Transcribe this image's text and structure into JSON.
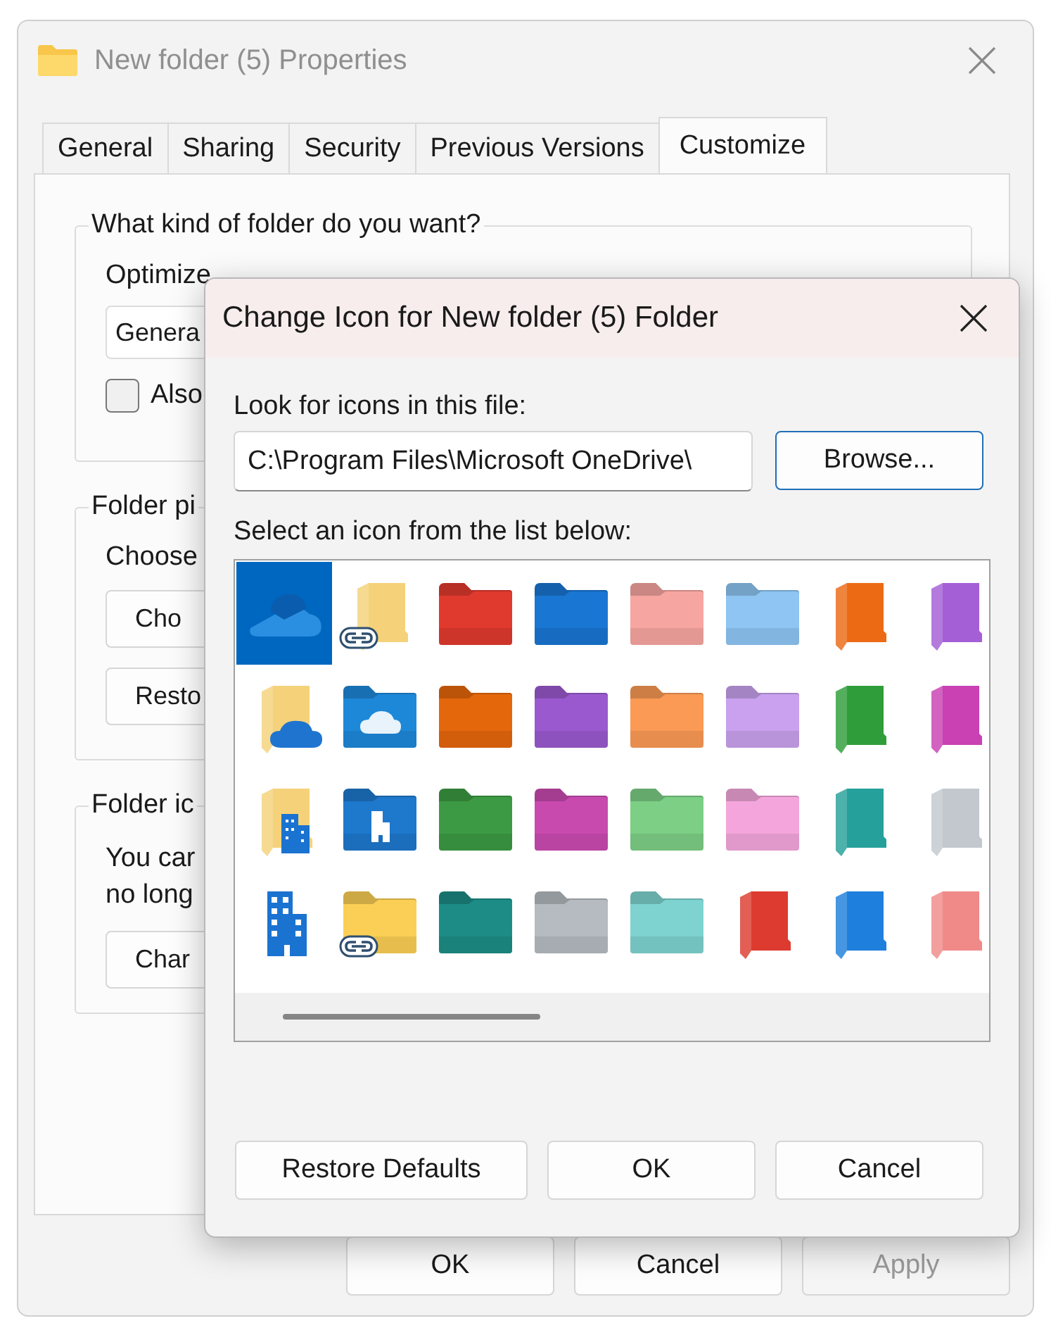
{
  "back_window": {
    "title": "New folder (5) Properties",
    "tabs": [
      {
        "label": "General",
        "selected": false
      },
      {
        "label": "Sharing",
        "selected": false
      },
      {
        "label": "Security",
        "selected": false
      },
      {
        "label": "Previous Versions",
        "selected": false
      },
      {
        "label": "Customize",
        "selected": true
      }
    ],
    "folder_type_group": {
      "legend": "What kind of folder do you want?",
      "optimize_label": "Optimize",
      "dropdown_value": "Genera",
      "checkbox": {
        "label": "Also",
        "checked": false
      }
    },
    "pictures_group": {
      "legend": "Folder pi",
      "text": "Choose",
      "buttons": [
        "Cho",
        "Resto"
      ]
    },
    "icons_group": {
      "legend": "Folder ic",
      "text_lines": [
        "You car",
        "no long"
      ],
      "button": "Char"
    },
    "buttons": [
      {
        "label": "OK",
        "disabled": false
      },
      {
        "label": "Cancel",
        "disabled": false
      },
      {
        "label": "Apply",
        "disabled": true
      }
    ]
  },
  "dialog": {
    "title": "Change Icon for New folder (5) Folder",
    "file_label": "Look for icons in this file:",
    "file_value": "C:\\Program Files\\Microsoft OneDrive\\",
    "browse_button": "Browse...",
    "list_label": "Select an icon from the list below:",
    "icons": [
      {
        "kind": "cloud",
        "color": "#2a8fe0",
        "selected": true
      },
      {
        "kind": "side-link",
        "color": "#f5d27a",
        "selected": false
      },
      {
        "kind": "folder",
        "color": "#e03a2e",
        "selected": false
      },
      {
        "kind": "folder",
        "color": "#1976d2",
        "selected": false
      },
      {
        "kind": "folder",
        "color": "#f7a5a0",
        "selected": false
      },
      {
        "kind": "folder",
        "color": "#8ec5f2",
        "selected": false
      },
      {
        "kind": "side",
        "color": "#ec6a14",
        "selected": false
      },
      {
        "kind": "side",
        "color": "#a45fd6",
        "selected": false
      },
      {
        "kind": "side-cloud",
        "color": "#f5d27a",
        "selected": false
      },
      {
        "kind": "folder-cloud",
        "color": "#1e88d8",
        "selected": false
      },
      {
        "kind": "folder",
        "color": "#e4670c",
        "selected": false
      },
      {
        "kind": "folder",
        "color": "#9b59d0",
        "selected": false
      },
      {
        "kind": "folder",
        "color": "#fb9a55",
        "selected": false
      },
      {
        "kind": "folder",
        "color": "#c9a1ee",
        "selected": false
      },
      {
        "kind": "side",
        "color": "#2f9e3a",
        "selected": false
      },
      {
        "kind": "side",
        "color": "#c941b3",
        "selected": false
      },
      {
        "kind": "side-building",
        "color": "#f5d27a",
        "selected": false
      },
      {
        "kind": "folder-building",
        "color": "#1e78cc",
        "selected": false
      },
      {
        "kind": "folder",
        "color": "#3c9a44",
        "selected": false
      },
      {
        "kind": "folder",
        "color": "#c94aaf",
        "selected": false
      },
      {
        "kind": "folder",
        "color": "#7ccf85",
        "selected": false
      },
      {
        "kind": "folder",
        "color": "#f4a6dc",
        "selected": false
      },
      {
        "kind": "side",
        "color": "#26a09a",
        "selected": false
      },
      {
        "kind": "side",
        "color": "#c2c8cd",
        "selected": false
      },
      {
        "kind": "building",
        "color": "#1a73d0",
        "selected": false
      },
      {
        "kind": "folder-link",
        "color": "#fbcf55",
        "selected": false
      },
      {
        "kind": "folder",
        "color": "#1d8c86",
        "selected": false
      },
      {
        "kind": "folder",
        "color": "#b5bbc0",
        "selected": false
      },
      {
        "kind": "folder",
        "color": "#7ed3d0",
        "selected": false
      },
      {
        "kind": "side",
        "color": "#dd3b30",
        "selected": false
      },
      {
        "kind": "side",
        "color": "#1f7fdc",
        "selected": false
      },
      {
        "kind": "side",
        "color": "#f08a88",
        "selected": false
      }
    ],
    "buttons": [
      "Restore Defaults",
      "OK",
      "Cancel"
    ]
  }
}
